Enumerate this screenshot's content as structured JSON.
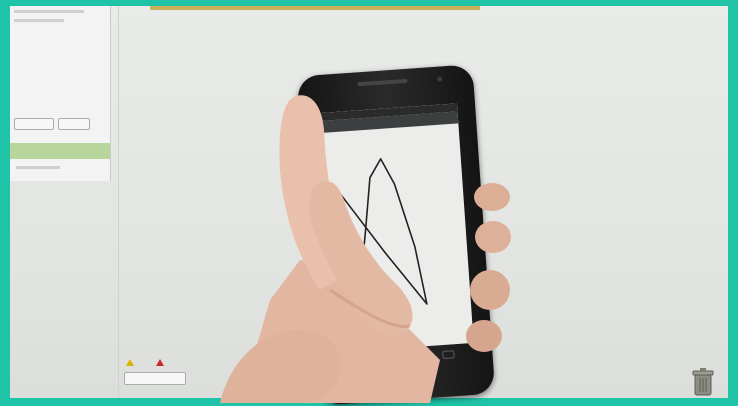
{
  "left_panel": {
    "line1": "",
    "line2": "",
    "btn_a": "",
    "btn_b": "",
    "list_item": ""
  },
  "bottom_widget": {
    "warnings_count": "",
    "errors_count": "",
    "show_warnings": ""
  },
  "phone": {
    "app_title": ""
  },
  "colors": {
    "frame": "#1fc3a7",
    "phone_body": "#1a1a1a",
    "skin": "#e5b9a3"
  },
  "icons": {
    "trash": "trash-icon",
    "warning": "warning-icon",
    "error": "error-icon"
  }
}
